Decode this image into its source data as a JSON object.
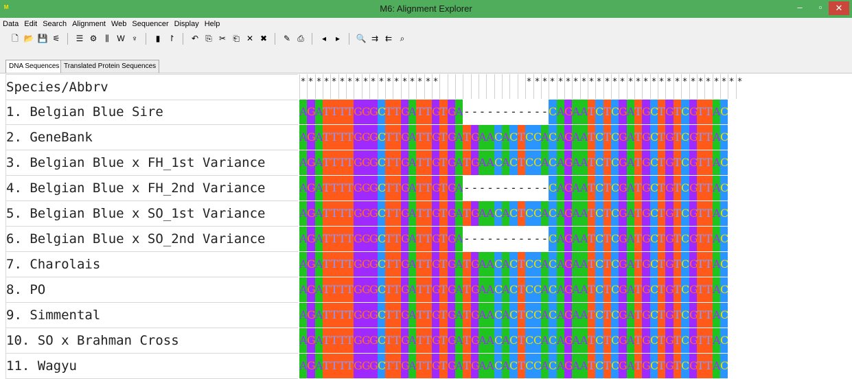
{
  "window": {
    "title": "M6: Alignment Explorer"
  },
  "menu": [
    "Data",
    "Edit",
    "Search",
    "Alignment",
    "Web",
    "Sequencer",
    "Display",
    "Help"
  ],
  "toolbar": [
    {
      "name": "new-file-icon",
      "glyph": "🗋"
    },
    {
      "name": "open-folder-icon",
      "glyph": "📂"
    },
    {
      "name": "save-icon",
      "glyph": "💾"
    },
    {
      "name": "sequence-data-icon",
      "glyph": "⚟"
    },
    {
      "name": "align-icon",
      "glyph": "☰"
    },
    {
      "name": "translate-icon",
      "glyph": "⚙"
    },
    {
      "name": "codon-icon",
      "glyph": "⫼"
    },
    {
      "name": "clustalw-icon",
      "glyph": "W"
    },
    {
      "name": "muscle-icon",
      "glyph": "♆"
    },
    {
      "name": "mark-site-icon",
      "glyph": "▮"
    },
    {
      "name": "unmark-icon",
      "glyph": "↾"
    },
    {
      "name": "undo-icon",
      "glyph": "↶"
    },
    {
      "name": "copy-icon",
      "glyph": "⎘"
    },
    {
      "name": "cut-icon",
      "glyph": "✂"
    },
    {
      "name": "paste-icon",
      "glyph": "⎗"
    },
    {
      "name": "delete-icon",
      "glyph": "✕"
    },
    {
      "name": "delete-gap-icon",
      "glyph": "✖"
    },
    {
      "name": "edit-icon",
      "glyph": "✎"
    },
    {
      "name": "clipboard-icon",
      "glyph": "⎙"
    },
    {
      "name": "previous-icon",
      "glyph": "◂"
    },
    {
      "name": "next-icon",
      "glyph": "▸"
    },
    {
      "name": "find-icon",
      "glyph": "🔍"
    },
    {
      "name": "find-next-icon",
      "glyph": "⇉"
    },
    {
      "name": "find-previous-icon",
      "glyph": "⇇"
    },
    {
      "name": "find-motif-icon",
      "glyph": "⌕"
    }
  ],
  "tabs": [
    {
      "label": "DNA Sequences",
      "active": true
    },
    {
      "label": "Translated Protein Sequences",
      "active": false
    }
  ],
  "header": {
    "label": "Species/Abbrv",
    "conserved_marks": "******************           ****************************"
  },
  "sequences": [
    {
      "name": "1. Belgian Blue Sire",
      "seq": "AGATTTTGGGCTTGATTGTGA-----------CAGAATCTCGATGCTGTCGTTAC"
    },
    {
      "name": "2. GeneBank",
      "seq": "AGATTTTGGGCTTGATTGTGATGAACACTCCACAGAATCTCGATGCTGTCGTTAC"
    },
    {
      "name": "3. Belgian Blue x FH_1st Variance",
      "seq": "AGATTTTGGGCTTGATTGTGATGAACACTCCACAGAATCTCGATGCTGTCGTTAC"
    },
    {
      "name": "4. Belgian Blue x FH_2nd Variance",
      "seq": "AGATTTTGGGCTTGATTGTGA-----------CAGAATCTCGATGCTGTCGTTAC"
    },
    {
      "name": "5. Belgian Blue x SO_1st Variance",
      "seq": "AGATTTTGGGCTTGATTGTGATGAACACTCCACAGAATCTCGATGCTGTCGTTAC"
    },
    {
      "name": "6. Belgian Blue x SO_2nd Variance",
      "seq": "AGATTTTGGGCTTGATTGTGA-----------CAGAATCTCGATGCTGTCGTTAC"
    },
    {
      "name": "7. Charolais",
      "seq": "AGATTTTGGGCTTGATTGTGATGAACACTCCACAGAATCTCGATGCTGTCGTTAC"
    },
    {
      "name": "8. PO",
      "seq": "AGATTTTGGGCTTGATTGTGATGAACACTCCACAGAATCTCGATGCTGTCGTTAC"
    },
    {
      "name": "9. Simmental",
      "seq": "AGATTTTGGGCTTGATTGTGATGAACACTCCACAGAATCTCGATGCTGTCGTTAC"
    },
    {
      "name": "10. SO x Brahman Cross",
      "seq": "AGATTTTGGGCTTGATTGTGATGAACACTCCACAGAATCTCGATGCTGTCGTTAC"
    },
    {
      "name": "11. Wagyu",
      "seq": "AGATTTTGGGCTTGATTGTGATGAACACTCCACAGAATCTCGATGCTGTCGTTAC"
    }
  ],
  "colors": {
    "A": {
      "bg": "#1fc41f",
      "fg": "#9e2aff"
    },
    "G": {
      "bg": "#9e2aff",
      "fg": "#ff6f2a"
    },
    "T": {
      "bg": "#ff5a1a",
      "fg": "#8a9aff"
    },
    "C": {
      "bg": "#2a95ff",
      "fg": "#e8e000"
    },
    "titlebar": "#4fad5b"
  }
}
